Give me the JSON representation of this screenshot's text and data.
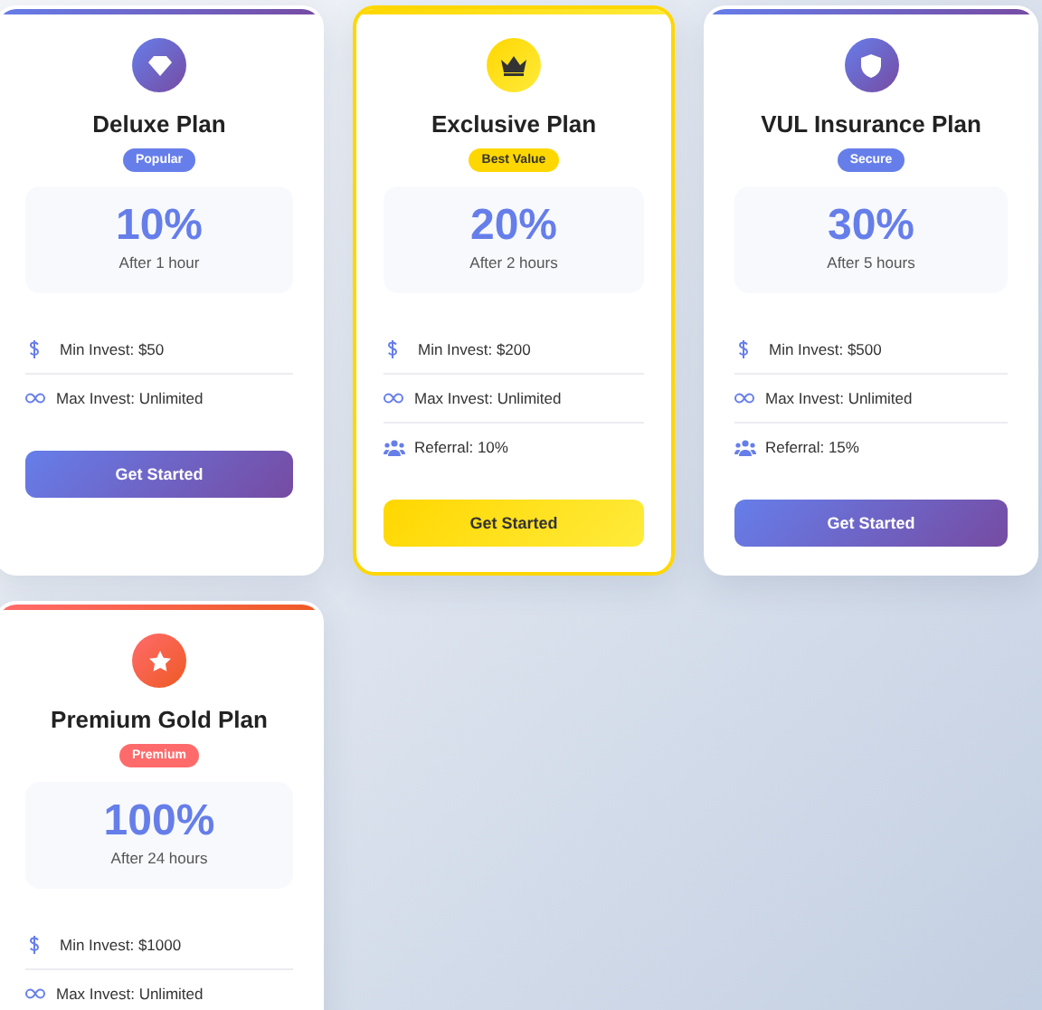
{
  "plans": [
    {
      "featured": false,
      "title": "Deluxe Plan",
      "badge": "Popular",
      "rate": "10%",
      "period": "After 1 hour",
      "features": [
        {
          "kind": "min",
          "text": "Min Invest: $50"
        },
        {
          "kind": "max",
          "text": "Max Invest: Unlimited"
        }
      ],
      "button": "Get Started"
    },
    {
      "featured": true,
      "title": "Exclusive Plan",
      "badge": "Best Value",
      "rate": "20%",
      "period": "After 2 hours",
      "features": [
        {
          "kind": "min",
          "text": "Min Invest: $200"
        },
        {
          "kind": "max",
          "text": "Max Invest: Unlimited"
        },
        {
          "kind": "referral",
          "text": "Referral: 10%"
        }
      ],
      "button": "Get Started"
    },
    {
      "featured": false,
      "title": "VUL Insurance Plan",
      "badge": "Secure",
      "rate": "30%",
      "period": "After 5 hours",
      "features": [
        {
          "kind": "min",
          "text": "Min Invest: $500"
        },
        {
          "kind": "max",
          "text": "Max Invest: Unlimited"
        },
        {
          "kind": "referral",
          "text": "Referral: 15%"
        }
      ],
      "button": "Get Started"
    },
    {
      "featured": false,
      "title": "Premium Gold Plan",
      "badge": "Premium",
      "rate": "100%",
      "period": "After 24 hours",
      "features": [
        {
          "kind": "min",
          "text": "Min Invest: $1000"
        },
        {
          "kind": "max",
          "text": "Max Invest: Unlimited"
        }
      ]
    }
  ]
}
